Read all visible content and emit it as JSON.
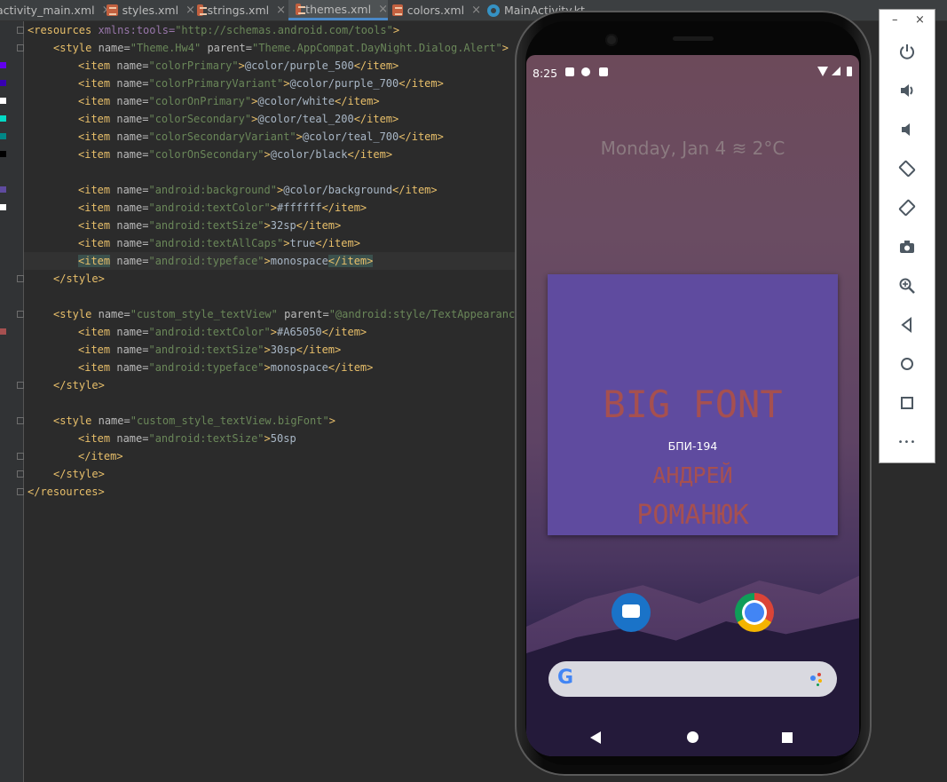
{
  "tabs": [
    {
      "label": "activity_main.xml",
      "icon": "xml-file-icon"
    },
    {
      "label": "styles.xml",
      "icon": "xml-file-icon"
    },
    {
      "label": "strings.xml",
      "icon": "xml-file-icon"
    },
    {
      "label": "themes.xml",
      "icon": "xml-file-icon",
      "active": true
    },
    {
      "label": "colors.xml",
      "icon": "xml-file-icon"
    },
    {
      "label": "MainActivity.kt",
      "icon": "kotlin-class-icon"
    }
  ],
  "tab_close_glyph": "×",
  "code": {
    "l1_tag": "<resources",
    "l1_attr": "xmlns:tools=",
    "l1_val": "\"http://schemas.android.com/tools\"",
    "l1_end": ">",
    "l2_tag": "<style",
    "l2_a1": "name=",
    "l2_v1": "\"Theme.Hw4\"",
    "l2_a2": "parent=",
    "l2_v2": "\"Theme.AppCompat.DayNight.Dialog.Alert\"",
    "l2_end": ">",
    "items_theme": [
      {
        "name": "\"colorPrimary\"",
        "value": "@color/purple_500"
      },
      {
        "name": "\"colorPrimaryVariant\"",
        "value": "@color/purple_700"
      },
      {
        "name": "\"colorOnPrimary\"",
        "value": "@color/white"
      },
      {
        "name": "\"colorSecondary\"",
        "value": "@color/teal_200"
      },
      {
        "name": "\"colorSecondaryVariant\"",
        "value": "@color/teal_700"
      },
      {
        "name": "\"colorOnSecondary\"",
        "value": "@color/black"
      }
    ],
    "items_android": [
      {
        "name": "\"android:background\"",
        "value": "@color/background"
      },
      {
        "name": "\"android:textColor\"",
        "value": "#ffffff"
      },
      {
        "name": "\"android:textSize\"",
        "value": "32sp"
      },
      {
        "name": "\"android:textAllCaps\"",
        "value": "true"
      },
      {
        "name": "\"android:typeface\"",
        "value": "monospace"
      }
    ],
    "item_open": "<item",
    "item_attr": "name=",
    "item_gt": ">",
    "item_close": "</item>",
    "style_close": "</style>",
    "s2_tag": "<style",
    "s2_a1": "name=",
    "s2_v1": "\"custom_style_textView\"",
    "s2_a2": "parent=",
    "s2_v2": "\"@android:style/TextAppearance\"",
    "items_custom": [
      {
        "name": "\"android:textColor\"",
        "value": "#A65050"
      },
      {
        "name": "\"android:textSize\"",
        "value": "30sp"
      },
      {
        "name": "\"android:typeface\"",
        "value": "monospace"
      }
    ],
    "s3_tag": "<style",
    "s3_a1": "name=",
    "s3_v1": "\"custom_style_textView.bigFont\"",
    "s3_end": ">",
    "s3_item_name": "\"android:textSize\"",
    "s3_item_value": "50sp",
    "resources_close": "</resources>"
  },
  "gutter_swatches": [
    "#6200ee",
    "#3700b3",
    "#ffffff",
    "#03dac5",
    "#018786",
    "#000000",
    "#5f4b9f",
    "#ffffff",
    "#a65050"
  ],
  "phone": {
    "time": "8:25",
    "date_weather": "Monday, Jan 4 ≋ 2°C",
    "widget": {
      "big_font": "BIG FONT",
      "group": "БПИ-194",
      "name_first": "АНДРЕЙ",
      "name_last": "РОМАНЮК",
      "background": "#5f4b9f",
      "text_color": "#a65050"
    },
    "dock_apps": [
      "messages-icon",
      "chrome-icon"
    ],
    "search_logo": "G"
  },
  "emulator_toolbar": {
    "minimize": "–",
    "close": "×",
    "buttons": [
      "power-icon",
      "volume-up-icon",
      "volume-down-icon",
      "rotate-left-icon",
      "rotate-right-icon",
      "camera-icon",
      "zoom-icon",
      "back-icon",
      "home-icon",
      "overview-icon",
      "more-icon"
    ],
    "more_glyph": "•••"
  }
}
